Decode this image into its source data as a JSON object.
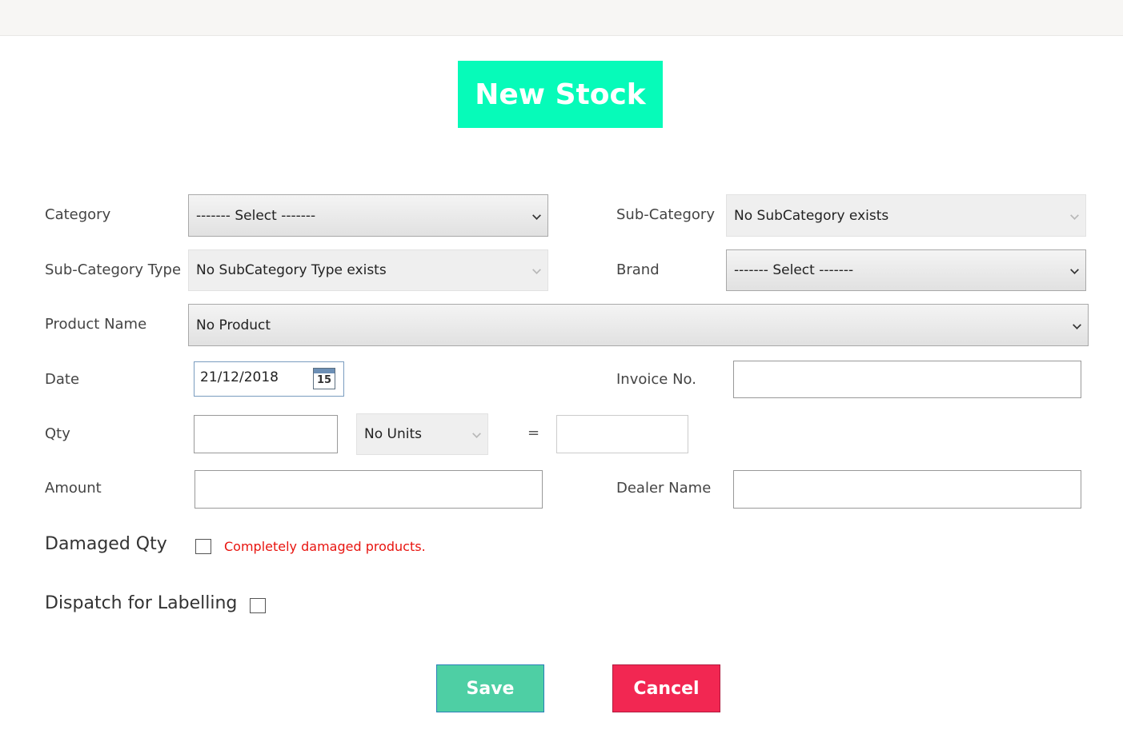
{
  "header": {},
  "form": {
    "title": "New Stock",
    "title_bg": "#06fbb9",
    "category": {
      "label": "Category",
      "value": "------- Select -------"
    },
    "sub_category": {
      "label": "Sub-Category",
      "value": "No SubCategory exists"
    },
    "sub_category_type": {
      "label": "Sub-Category Type",
      "value": "No SubCategory Type exists"
    },
    "brand": {
      "label": "Brand",
      "value": "------- Select -------"
    },
    "product_name": {
      "label": "Product Name",
      "value": "No Product"
    },
    "date": {
      "label": "Date",
      "value": "21/12/2018",
      "calendar_icon_day": "15"
    },
    "invoice_no": {
      "label": "Invoice No.",
      "value": ""
    },
    "qty": {
      "label": "Qty",
      "value": "",
      "units_value": "No Units",
      "equals": "=",
      "result_value": ""
    },
    "amount": {
      "label": "Amount",
      "value": ""
    },
    "dealer_name": {
      "label": "Dealer Name",
      "value": ""
    },
    "damaged_qty": {
      "label": "Damaged Qty",
      "checked": false,
      "note": "Completely damaged products.",
      "note_color": "#e8140f"
    },
    "dispatch": {
      "label": "Dispatch for Labelling",
      "checked": false
    }
  },
  "buttons": {
    "save_label": "Save",
    "save_color": "#4ecfa4",
    "cancel_label": "Cancel",
    "cancel_color": "#f22752"
  }
}
